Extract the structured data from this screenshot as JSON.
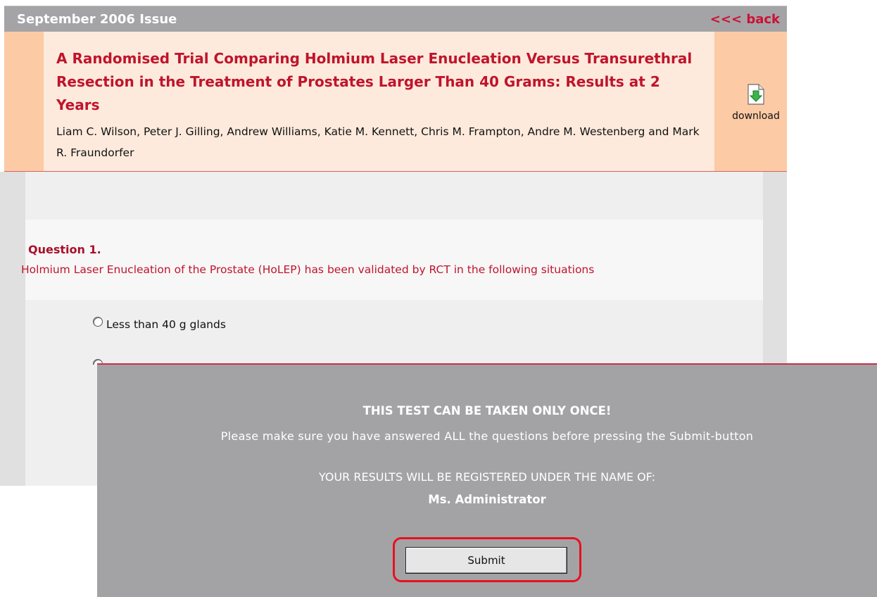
{
  "header": {
    "issue_title": "September 2006 Issue",
    "back_label": "<<< back"
  },
  "article": {
    "title": "A Randomised Trial Comparing Holmium Laser Enucleation Versus Transurethral Resection in the Treatment of Prostates Larger Than 40 Grams: Results at 2 Years",
    "authors": "Liam C. Wilson, Peter J. Gilling, Andrew Williams, Katie M. Kennett, Chris M. Frampton, Andre M. Westenberg and Mark R. Fraundorfer",
    "download_label": "download",
    "download_icon": "download-icon"
  },
  "question": {
    "label": "Question 1.",
    "text": "Holmium Laser Enucleation of the Prostate (HoLEP) has been validated by RCT in the following situations",
    "options": [
      "Less than 40 g glands"
    ]
  },
  "modal": {
    "warning_title": "THIS TEST CAN BE TAKEN ONLY ONCE!",
    "warning_text": "Please make sure you have answered ALL the questions before pressing the Submit-button",
    "register_text": "YOUR RESULTS WILL BE REGISTERED UNDER THE NAME OF:",
    "register_name": "Ms. Administrator",
    "submit_label": "Submit"
  },
  "colors": {
    "accent_red": "#c0142c",
    "header_band": "#fccaa5",
    "header_inner": "#fdeadc",
    "modal_bg": "#a3a3a6",
    "highlight_ring": "#e8101e"
  }
}
